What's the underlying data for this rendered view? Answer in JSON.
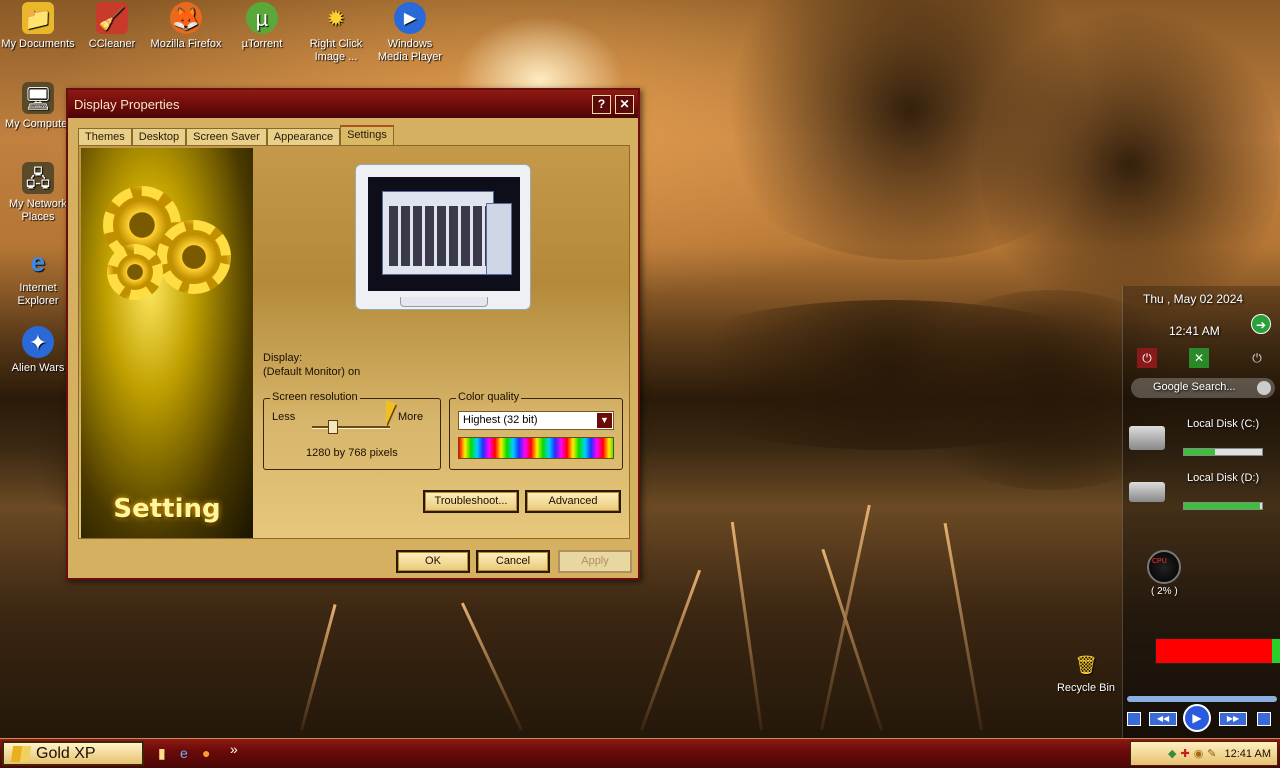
{
  "desktop": {
    "icons": [
      {
        "label": "My Documents",
        "glyph": "📁"
      },
      {
        "label": "CCleaner",
        "glyph": "🧹"
      },
      {
        "label": "Mozilla Firefox",
        "glyph": "🦊"
      },
      {
        "label": "µTorrent",
        "glyph": "µ"
      },
      {
        "label": "Right Click Image ...",
        "glyph": "✹"
      },
      {
        "label": "Windows Media Player",
        "glyph": "▶"
      },
      {
        "label": "My Computer",
        "glyph": "🖥"
      },
      {
        "label": "My Network Places",
        "glyph": "🖧"
      },
      {
        "label": "Internet Explorer",
        "glyph": "e"
      },
      {
        "label": "Alien Wars",
        "glyph": "✦"
      },
      {
        "label": "Recycle Bin",
        "glyph": "🗑"
      }
    ]
  },
  "dialog": {
    "title": "Display Properties",
    "help_glyph": "?",
    "close_glyph": "✕",
    "tabs": [
      "Themes",
      "Desktop",
      "Screen Saver",
      "Appearance",
      "Settings"
    ],
    "active_tab": "Settings",
    "banner_text": "Setting",
    "display_label": "Display:",
    "display_value": "(Default Monitor) on",
    "resolution": {
      "group_title": "Screen resolution",
      "less": "Less",
      "more": "More",
      "value": "1280 by 768 pixels"
    },
    "color_quality": {
      "group_title": "Color quality",
      "selected": "Highest (32 bit)"
    },
    "buttons": {
      "troubleshoot": "Troubleshoot...",
      "advanced": "Advanced",
      "ok": "OK",
      "cancel": "Cancel",
      "apply": "Apply"
    }
  },
  "sidebar": {
    "date": "Thu , May 02 2024",
    "time": "12:41 AM",
    "search_placeholder": "Google Search...",
    "disks": [
      {
        "label": "Local Disk (C:)",
        "used_fraction": 0.4
      },
      {
        "label": "Local Disk (D:)",
        "used_fraction": 0.98
      }
    ],
    "cpu_label": "CPU",
    "cpu_value": "( 2% )"
  },
  "taskbar": {
    "start_label": "Gold XP",
    "chevron": "»",
    "clock": "12:41 AM"
  },
  "colors": {
    "title_red": "#6a0b0a",
    "accent_gold": "#d4b060"
  }
}
